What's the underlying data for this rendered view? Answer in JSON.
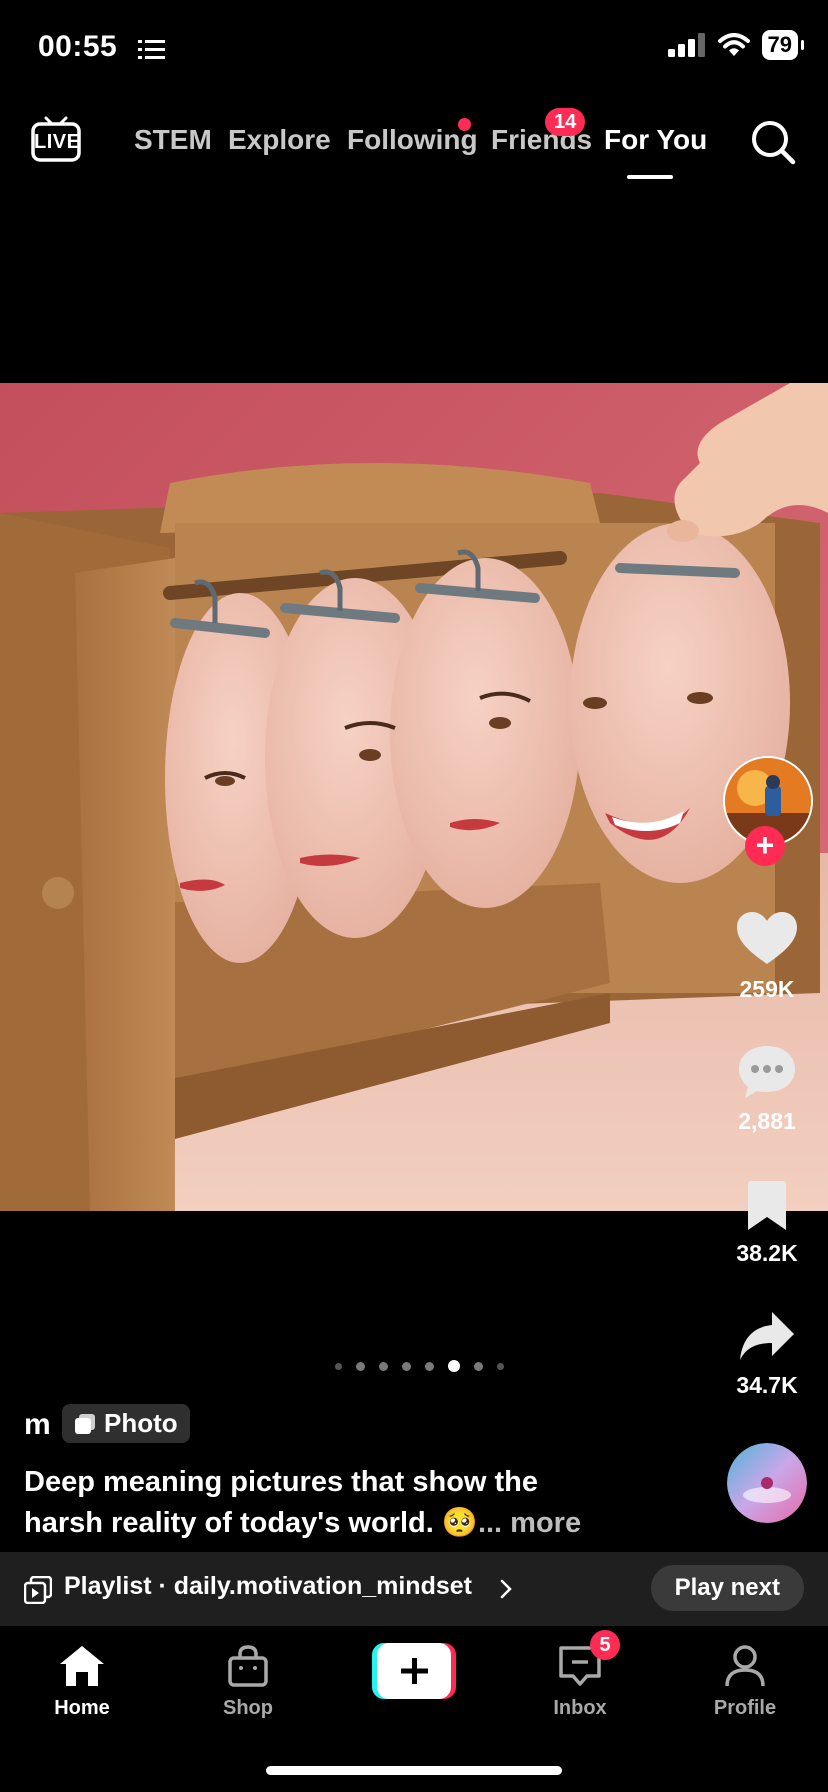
{
  "status_bar": {
    "time": "00:55",
    "battery": "79"
  },
  "top_nav": {
    "items": [
      {
        "label": "STEM"
      },
      {
        "label": "Explore"
      },
      {
        "label": "Following"
      },
      {
        "label": "Friends",
        "badge": "14"
      },
      {
        "label": "For You",
        "active": true
      }
    ],
    "live_label": "LIVE"
  },
  "actions": {
    "likes": "259K",
    "comments": "2,881",
    "saves": "38.2K",
    "shares": "34.7K"
  },
  "carousel": {
    "count": 8,
    "active_index": 5
  },
  "post": {
    "author": "m",
    "type_label": "Photo",
    "caption_line1": "Deep meaning pictures that show the",
    "caption_line2": "harsh reality of today's world. 🥺",
    "more": "... more"
  },
  "playlist": {
    "label": "Playlist · daily.motivation_mindset",
    "play_next": "Play next"
  },
  "tabbar": {
    "home": "Home",
    "shop": "Shop",
    "inbox": "Inbox",
    "inbox_badge": "5",
    "profile": "Profile"
  },
  "colors": {
    "accent": "#fe2c55",
    "wall": "#c8525f",
    "wood": "#b07a4a"
  }
}
